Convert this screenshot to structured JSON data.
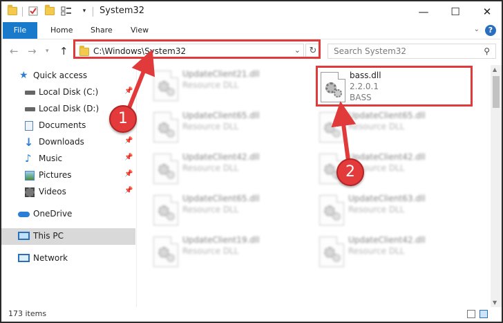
{
  "window": {
    "title": "System32",
    "controls": {
      "minimize": "—",
      "maximize": "☐",
      "close": "✕"
    }
  },
  "ribbon": {
    "tabs": [
      "File",
      "Home",
      "Share",
      "View"
    ],
    "help": "?"
  },
  "nav": {
    "address": "C:\\Windows\\System32",
    "search_placeholder": "Search System32"
  },
  "sidebar": {
    "items": [
      {
        "label": "Quick access",
        "icon": "star-icon"
      },
      {
        "label": "Local Disk (C:)",
        "icon": "drive-icon",
        "pinned": true
      },
      {
        "label": "Local Disk (D:)",
        "icon": "drive-icon",
        "pinned": true
      },
      {
        "label": "Documents",
        "icon": "documents-icon",
        "pinned": true
      },
      {
        "label": "Downloads",
        "icon": "downloads-icon",
        "pinned": true
      },
      {
        "label": "Music",
        "icon": "music-icon",
        "pinned": true
      },
      {
        "label": "Pictures",
        "icon": "pictures-icon",
        "pinned": true
      },
      {
        "label": "Videos",
        "icon": "videos-icon",
        "pinned": true
      },
      {
        "label": "OneDrive",
        "icon": "cloud-icon"
      },
      {
        "label": "This PC",
        "icon": "pc-icon",
        "selected": true
      },
      {
        "label": "Network",
        "icon": "network-icon"
      }
    ]
  },
  "files": {
    "left": [
      {
        "name": "UpdateClient21.dll",
        "type": "Resource DLL"
      },
      {
        "name": "UpdateClient65.dll",
        "type": "Resource DLL"
      },
      {
        "name": "UpdateClient42.dll",
        "type": "Resource DLL"
      },
      {
        "name": "UpdateClient65.dll",
        "type": "Resource DLL"
      },
      {
        "name": "UpdateClient19.dll",
        "type": "Resource DLL"
      }
    ],
    "right": [
      {
        "name": "bass.dll",
        "version": "2.2.0.1",
        "type": "BASS"
      },
      {
        "name": "UpdateClient65.dll",
        "type": "Resource DLL"
      },
      {
        "name": "UpdateClient42.dll",
        "type": "Resource DLL"
      },
      {
        "name": "UpdateClient63.dll",
        "type": "Resource DLL"
      },
      {
        "name": "UpdateClient42.dll",
        "type": "Resource DLL"
      }
    ]
  },
  "status": {
    "count": "173 items"
  },
  "annotations": {
    "badge1": "1",
    "badge2": "2",
    "color": "#e03a3a"
  }
}
